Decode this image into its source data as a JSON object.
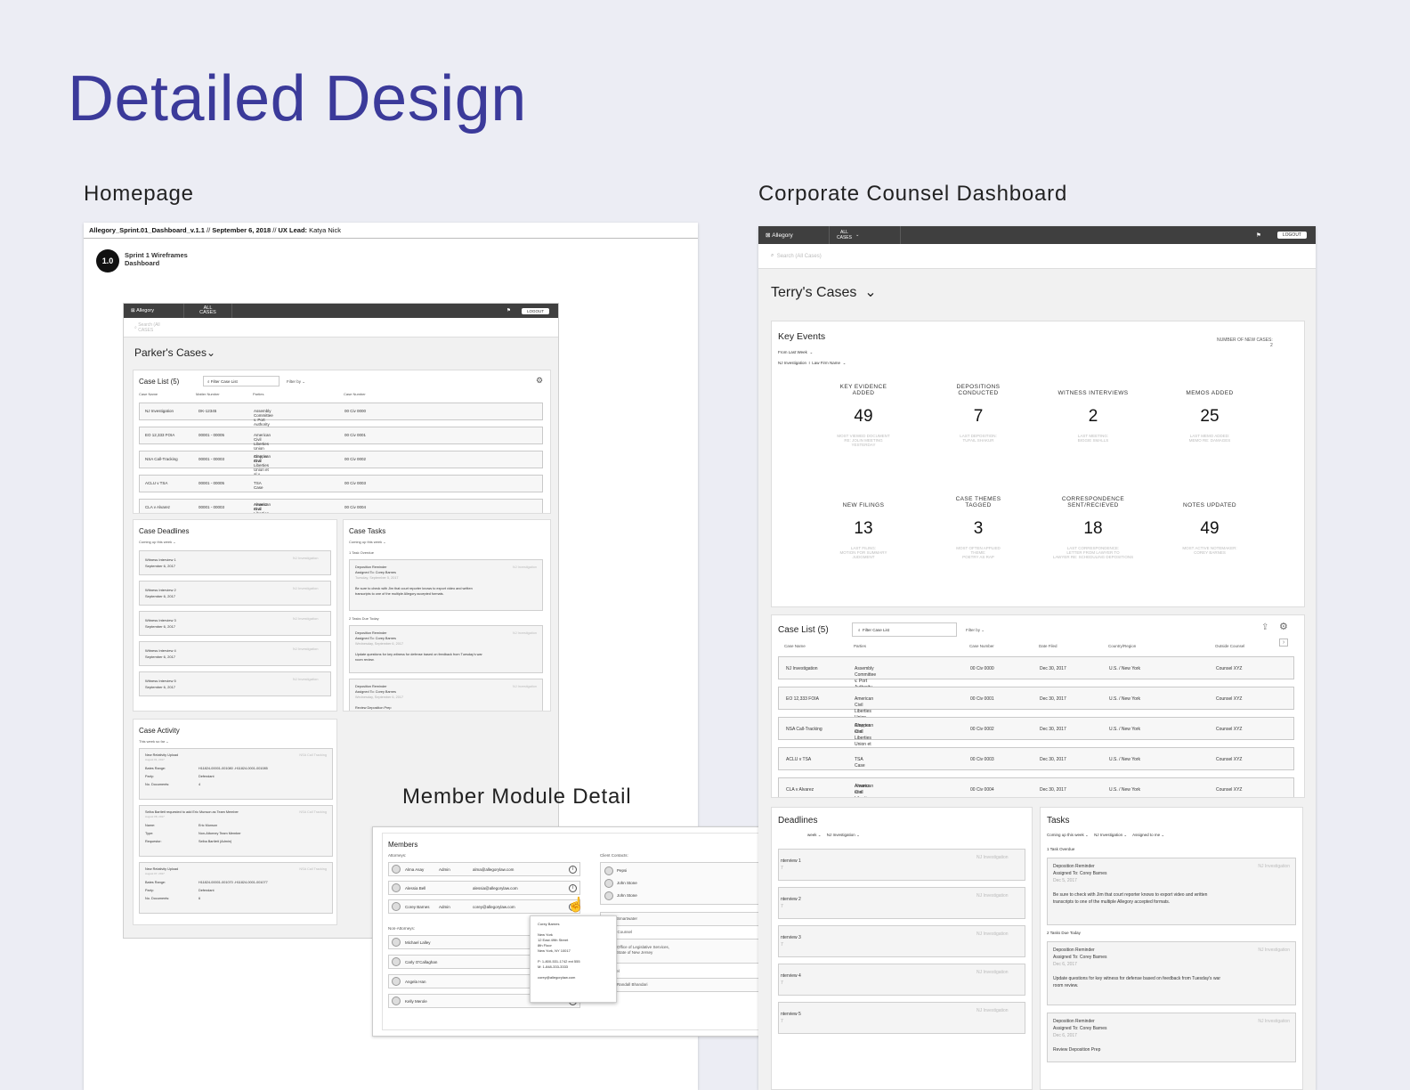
{
  "page": {
    "title": "Detailed Design",
    "sections": {
      "homepage": "Homepage",
      "corporate": "Corporate Counsel Dashboard",
      "member": "Member Module Detail"
    }
  },
  "homepage": {
    "file": "Allegory_Sprint.01_Dashboard_v.1.1",
    "sep1": "//",
    "date": "September 6, 2018",
    "sep2": "//",
    "ux_label": "UX Lead:",
    "ux_name": "Katya Nick",
    "badge": "1.0",
    "badge_l1": "Sprint 1 Wireframes",
    "badge_l2": "Dashboard",
    "app": "Allegory",
    "all": "ALL",
    "cases": "CASES",
    "logout": "LOGOUT",
    "search": "Search (All",
    "search2": "Cases)",
    "heading": "Parker's Cases",
    "caselist": {
      "title": "Case List (5)",
      "filter": "Filter Case List",
      "filterby": "Filter by",
      "cols": [
        "Case Name",
        "Matter Number",
        "Parties",
        "Case Number"
      ],
      "rows": [
        [
          "NJ Investigation",
          "DK-12345",
          "Assembly Committee v. Port Authority",
          "",
          "00 Civ 0000"
        ],
        [
          "EO 12,333 FOIA",
          "00001 - 00005",
          "American Civil Liberties Union",
          "",
          "00 Civ 0001"
        ],
        [
          "NSA Call-Tracking",
          "00001 - 00003",
          "American Civil Liberties Union et al v.",
          "Clapper et al",
          "00 Civ 0002"
        ],
        [
          "ACLU v TSA",
          "00001 - 00005",
          "TSA Case",
          "",
          "00 Civ 0003"
        ],
        [
          "CLA v Alvarez",
          "00001 - 00003",
          "American Civil Liberties Union et al v.",
          "Alvarez et al",
          "00 Civ 0004"
        ]
      ]
    },
    "deadlines": {
      "title": "Case Deadlines",
      "filter": "Coming up this week",
      "items": [
        [
          "Witness Interview 1",
          "September 6, 2017",
          "NJ Investigation"
        ],
        [
          "Witness Interview 2",
          "September 6, 2017",
          "NJ Investigation"
        ],
        [
          "Witness Interview 3",
          "September 6, 2017",
          "NJ Investigation"
        ],
        [
          "Witness Interview 4",
          "September 6, 2017",
          "NJ Investigation"
        ],
        [
          "Witness Interview 5",
          "September 6, 2017",
          "NJ Investigation"
        ]
      ]
    },
    "tasks": {
      "title": "Case Tasks",
      "filter": "Coming up this week",
      "overdue": "1 Task Overdue",
      "due": "2 Tasks Due Today",
      "t1": [
        "Deposition Reminder",
        "Assigned To: Corey Barnes",
        "Tuesday, September 5, 2017",
        "NJ Investigation",
        "Be sure to check with Jim that court reporter knows to export video and written",
        "transcripts to one of the multiple Allegory accepted formats."
      ],
      "t2": [
        "Deposition Reminder",
        "Assigned To: Corey Barnes",
        "Wednesday, September 6, 2017",
        "NJ Investigation",
        "Update questions for key witness for defense based on feedback from Tuesday's war",
        "room review."
      ],
      "t3": [
        "Deposition Reminder",
        "Assigned To: Corey Barnes",
        "Wednesday, September 6, 2017",
        "NJ Investigation",
        "Review Deposition Prep"
      ]
    },
    "activity": {
      "title": "Case Activity",
      "filter": "This week so far",
      "a1": [
        "New Relativity Upload",
        "August 01, 2017",
        "NSA Call Tracking",
        "Bates Range:",
        "H11824-00001-001080 -H11824-0001-001085",
        "Party:",
        "Defendant",
        "No. Documents:",
        "4"
      ],
      "a2": [
        "Selba Bartlett requested to add Eric Munson as Team Member",
        "August 08, 2017",
        "NSA Call Tracking",
        "Name:",
        "Eric Munson",
        "Type:",
        "Non-Attorney Team Member",
        "Requestor:",
        "Selba Bartlett (Admin)"
      ],
      "a3": [
        "New Relativity Upload",
        "August 07, 2017",
        "NSA Call Tracking",
        "Bates Range:",
        "H11824-00001-001070 -H11824-0001-001077",
        "Party:",
        "Defendant",
        "No. Documents:",
        "6"
      ]
    }
  },
  "member": {
    "title": "Members",
    "attorneys": "Attorneys:",
    "att": [
      [
        "Alma Asay",
        "Admin",
        "alma@allegorylaw.com"
      ],
      [
        "Alessia Bell",
        "",
        "alessia@allegorylaw.com"
      ],
      [
        "Corey Barnes",
        "Admin",
        "corey@allegorylaw.com"
      ]
    ],
    "non": "Non-Attorneys:",
    "nonatt": [
      "Michael Lalley",
      "Carly O'Callaghan",
      "Angela Han",
      "Kelly Merole"
    ],
    "popup": [
      "Corey Barnes",
      "New York",
      "12 East 49th Street",
      "8th Floor",
      "New York, NY 10017",
      "P: 1-800-531-1742  ext 555",
      "M: 1-848-333-3333",
      "corey@allegorylaw.com"
    ],
    "client": "Client Contacts:",
    "contacts": [
      "Pepsi",
      "John Stone",
      "John Stone"
    ],
    "g1": "Smartwater",
    "g2": "y Counsel",
    "g3a": "Office of Legislative Services,",
    "g3b": "State of New Jersey",
    "g4": "sel",
    "g5": "Randall Bhandari"
  },
  "corporate": {
    "app": "Allegory",
    "all": "ALL",
    "cases": "CASES",
    "logout": "LOGOUT",
    "search": "Search (All Cases)",
    "heading": "Terry's Cases",
    "key": {
      "title": "Key Events",
      "f1": "From Last Week",
      "f2a": "NJ Investigation",
      "f2b": "Law Firm Name",
      "new_l": "NUMBER OF NEW CASES:",
      "new_v": "2",
      "metrics": [
        {
          "l1": "KEY EVIDENCE",
          "l2": "ADDED",
          "v": "49",
          "s1": "MOST VIEWED DOCUMENT",
          "s2": "RE: JOLIN MEETING",
          "s3": "YESTERDAY"
        },
        {
          "l1": "DEPOSITIONS",
          "l2": "CONDUCTED",
          "v": "7",
          "s1": "LAST DEPOSITION:",
          "s2": "TUFAIL SHAKUR",
          "s3": ""
        },
        {
          "l1": "",
          "l2": "WITNESS INTERVIEWS",
          "v": "2",
          "s1": "LAST MEETING:",
          "s2": "BIGGIE SMALLS",
          "s3": ""
        },
        {
          "l1": "",
          "l2": "MEMOS ADDED",
          "v": "25",
          "s1": "LAST MEMO ADDED:",
          "s2": "MEMO RE: DAMAGES",
          "s3": ""
        },
        {
          "l1": "",
          "l2": "NEW FILINGS",
          "v": "13",
          "s1": "LAST FILING:",
          "s2": "MOTION FOR SUMMARY",
          "s3": "JUDGMENT"
        },
        {
          "l1": "CASE THEMES",
          "l2": "TAGGED",
          "v": "3",
          "s1": "MOST OFTEN APPLIED",
          "s2": "THEME:",
          "s3": "POETRY AS RAP"
        },
        {
          "l1": "CORRESPONDENCE",
          "l2": "SENT/RECIEVED",
          "v": "18",
          "s1": "LAST CORRESPONDENCE:",
          "s2": "LETTER FROM LAWYER TO",
          "s3": "LAWYER RE: SCHEDULING DEPOSITIONS"
        },
        {
          "l1": "",
          "l2": "NOTES UPDATED",
          "v": "49",
          "s1": "MOST ACTIVE NOTEMAKER:",
          "s2": "COREY BARNES",
          "s3": ""
        }
      ]
    },
    "caselist": {
      "title": "Case List (5)",
      "filter": "Filter Case List",
      "filterby": "Filter by",
      "cols": [
        "Case Name",
        "Parties",
        "Case Number",
        "Date Filed",
        "Country/Region",
        "Outside Counsel"
      ],
      "rows": [
        [
          "NJ Investigation",
          "Assembly Committee v. Port Authority",
          "",
          "00 Civ 0000",
          "Dec 30, 2017",
          "U.S. / New York",
          "Counsel XYZ"
        ],
        [
          "EO 12,333 FOIA",
          "American Civil Liberties Union",
          "",
          "00 Civ 0001",
          "Dec 30, 2017",
          "U.S. / New York",
          "Counsel XYZ"
        ],
        [
          "NSA Call-Tracking",
          "American Civil Liberties Union et al v.",
          "Clapper et al",
          "00 Civ 0002",
          "Dec 30, 2017",
          "U.S. / New York",
          "Counsel XYZ"
        ],
        [
          "ACLU v TSA",
          "TSA Case",
          "",
          "00 Civ 0003",
          "Dec 30, 2017",
          "U.S. / New York",
          "Counsel XYZ"
        ],
        [
          "CLA v Alvarez",
          "American Civil Liberties Union et al v.",
          "Alvarez et al",
          "00 Civ 0004",
          "Dec 30, 2017",
          "U.S. / New York",
          "Counsel XYZ"
        ]
      ]
    },
    "deadlines": {
      "title": "Deadlines",
      "filter": "week",
      "filter2": "NJ Investigation",
      "items": [
        [
          "nterview 1",
          "7",
          "NJ Investigation"
        ],
        [
          "nterview 2",
          "7",
          "NJ Investigation"
        ],
        [
          "nterview 3",
          "7",
          "NJ Investigation"
        ],
        [
          "nterview 4",
          "7",
          "NJ Investigation"
        ],
        [
          "nterview 5",
          "7",
          "NJ Investigation"
        ]
      ]
    },
    "tasks": {
      "title": "Tasks",
      "f1": "Coming up this week",
      "f2": "NJ Investigation",
      "f3": "Assigned to me",
      "overdue": "1 Task Overdue",
      "due": "2 Tasks Due Today",
      "t1": [
        "Deposition Reminder",
        "Assigned To: Corey Barnes",
        "Dec 5, 2017",
        "NJ Investigation",
        "Be sure to check with Jim that court reporter knows to export video and written",
        "transcripts to one of the multiple Allegory accepted formats."
      ],
      "t2": [
        "Deposition Reminder",
        "Assigned To: Corey Barnes",
        "Dec 6, 2017",
        "NJ Investigation",
        "Update questions for key witness for defense based on feedback from Tuesday's war",
        "room review."
      ],
      "t3": [
        "Deposition Reminder",
        "Assigned To: Corey Barnes",
        "Dec 6, 2017",
        "NJ Investigation",
        "Review Deposition Prep"
      ]
    }
  }
}
